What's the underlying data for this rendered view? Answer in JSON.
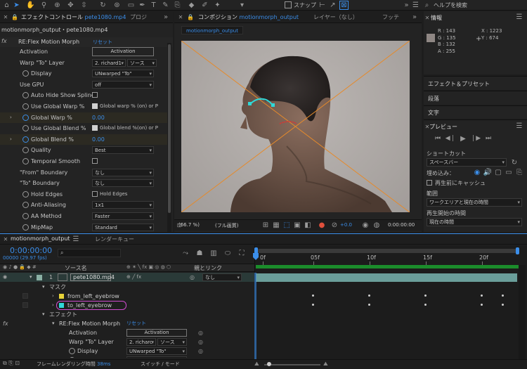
{
  "toolbar": {
    "snap_label": "スナップ",
    "help_placeholder": "ヘルプを検索"
  },
  "effect_panel": {
    "tab_label": "エフェクトコントロール",
    "tab_file": "pete1080.mp4",
    "tab2": "プロジ",
    "breadcrumb": "motionmorph_output・pete1080.mp4",
    "fx": "fx",
    "effect_name": "RE:Flex Motion Morph",
    "reset": "リセット",
    "rows": [
      {
        "label": "Activation",
        "type": "button",
        "value": "Activation"
      },
      {
        "label": "Warp \"To\" Layer",
        "type": "two",
        "value": "2. richard1",
        "value2": "ソース"
      },
      {
        "label": "Display",
        "type": "select",
        "value": "UNwarped \"To\"",
        "stop": true
      },
      {
        "label": "Use GPU",
        "type": "select",
        "value": "off"
      },
      {
        "label": "Auto Hide Show Splines",
        "type": "check",
        "stop": true
      },
      {
        "label": "Use Global Warp %",
        "type": "check",
        "stop": true,
        "checked": true,
        "value": "Global warp % (on) or P"
      },
      {
        "label": "Global Warp %",
        "type": "num",
        "stop": true,
        "blue": true,
        "arrow": true,
        "value": "0.00"
      },
      {
        "label": "Use Global Blend %",
        "type": "check",
        "stop": true,
        "checked": true,
        "value": "Global blend %(on) or P"
      },
      {
        "label": "Global Blend %",
        "type": "num",
        "stop": true,
        "blue": true,
        "arrow": true,
        "value": "0.00"
      },
      {
        "label": "Quality",
        "type": "select",
        "stop": true,
        "value": "Best"
      },
      {
        "label": "Temporal Smooth",
        "type": "check",
        "stop": true
      },
      {
        "label": "\"From\" Boundary",
        "type": "select",
        "value": "なし"
      },
      {
        "label": "\"To\" Boundary",
        "type": "select",
        "value": "なし"
      },
      {
        "label": "Hold Edges",
        "type": "check",
        "stop": true,
        "value": "Hold Edges"
      },
      {
        "label": "Anti-Aliasing",
        "type": "select",
        "stop": true,
        "value": "1x1"
      },
      {
        "label": "AA Method",
        "type": "select",
        "stop": true,
        "value": "Faster"
      },
      {
        "label": "MipMap",
        "type": "select",
        "stop": true,
        "value": "Standard"
      }
    ]
  },
  "comp_panel": {
    "tab_label": "コンポジション",
    "tab_name": "motionmorph_output",
    "tab2": "レイヤー（なし）",
    "tab3": "フッテ",
    "subtab": "motionmorph_output",
    "zoom": "(66.7 %)",
    "quality": "(フル画質)",
    "exposure": "+0.0",
    "time": "0:00:00:00"
  },
  "info_panel": {
    "title": "情報",
    "r": "R : 143",
    "g": "G : 135",
    "b": "B : 132",
    "a": "A : 255",
    "x": "X : 1223",
    "y": "Y : 674"
  },
  "right_panels": {
    "effects_presets": "エフェクト＆プリセット",
    "paragraph": "段落",
    "text": "文字",
    "preview": "プレビュー",
    "shortcut": "ショートカット",
    "shortcut_value": "スペースバー",
    "embed": "埋め込み：",
    "cache": "再生前にキャッシュ",
    "range": "範囲",
    "range_value": "ワークエリアと現在の時間",
    "play_start": "再生開始の時間",
    "play_start_value": "現在の時間"
  },
  "timeline": {
    "tab_label": "motionmorph_output",
    "tab2": "レンダーキュー",
    "timecode": "0:00:00:00",
    "fps": "00000 (29.97 fps)",
    "search_icon": "⌕",
    "col_source": "ソース名",
    "col_parent": "親とリンク",
    "ruler_ticks": [
      "0f",
      "05f",
      "10f",
      "15f",
      "20f"
    ],
    "layer": {
      "num": "1",
      "name": "pete1080.mp4",
      "parent": "なし"
    },
    "masks": "マスク",
    "mask1": "from_left_eyebrow",
    "mask2": "to_left_eyebrow",
    "effects": "エフェクト",
    "effect_name": "RE:Flex Motion Morph",
    "reset": "リセット",
    "sub_rows": [
      {
        "label": "Activation",
        "value": "Activation"
      },
      {
        "label": "Warp \"To\" Layer",
        "value": "2. richarc",
        "value2": "ソース"
      },
      {
        "label": "Display",
        "value": "UNwarped \"To\""
      },
      {
        "label": "Use GPU",
        "value": "off"
      }
    ],
    "footer_render": "フレームレンダリング時間",
    "footer_ms": "38ms",
    "footer_switch": "スイッチ / モード"
  },
  "colors": {
    "accent": "#3b8eea",
    "timebar": "#6a9e9a",
    "mask_pink": "#d04cd0",
    "mask_cyan": "#2fd8d8",
    "overlay_orange": "#e58a2b"
  }
}
